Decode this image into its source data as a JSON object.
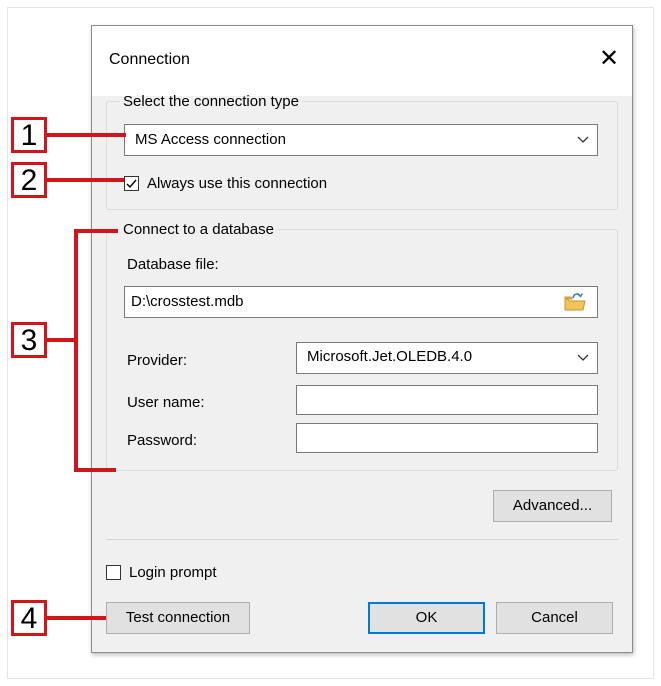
{
  "dialog": {
    "title": "Connection",
    "close_glyph": "✕"
  },
  "connection_type": {
    "legend": "Select the connection type",
    "selected": "MS Access connection",
    "always_use_label": "Always use this connection",
    "always_use_checked": true
  },
  "database": {
    "legend": "Connect to a database",
    "file_label": "Database file:",
    "file_value": "D:\\crosstest.mdb",
    "provider_label": "Provider:",
    "provider_value": "Microsoft.Jet.OLEDB.4.0",
    "username_label": "User name:",
    "username_value": "",
    "password_label": "Password:",
    "password_value": ""
  },
  "buttons": {
    "advanced": "Advanced...",
    "test_connection": "Test connection",
    "ok": "OK",
    "cancel": "Cancel"
  },
  "login_prompt": {
    "label": "Login prompt",
    "checked": false
  },
  "callouts": [
    "1",
    "2",
    "3",
    "4"
  ],
  "colors": {
    "callout_red": "#d2141b",
    "default_button_border": "#0078d7",
    "dialog_bg": "#f0f0f0"
  },
  "icons": {
    "browse": "open-folder-icon",
    "dropdown": "chevron-down-icon",
    "checkmark": "check-icon"
  }
}
